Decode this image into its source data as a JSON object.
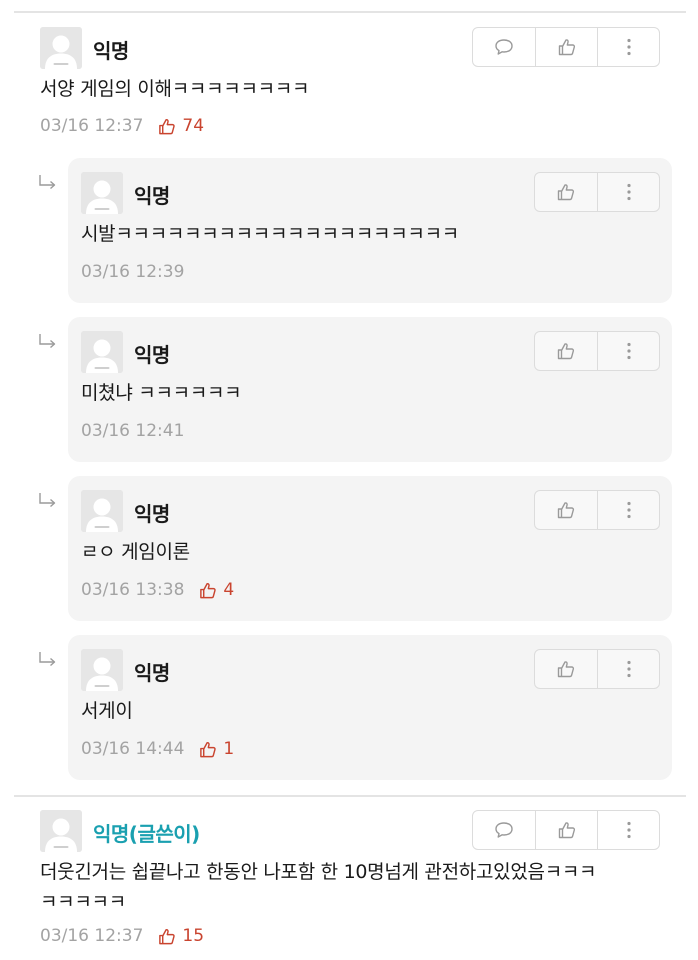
{
  "comments": [
    {
      "kind": "top",
      "author": "익명",
      "is_author": false,
      "text_lines": [
        "서양 게임의 이해ㅋㅋㅋㅋㅋㅋㅋㅋ"
      ],
      "time": "03/16 12:37",
      "likes": "74",
      "actions": [
        "speech-bubble-icon",
        "thumbs-up-icon",
        "more-vertical-icon"
      ]
    },
    {
      "kind": "reply",
      "author": "익명",
      "is_author": false,
      "text_lines": [
        "시발ㅋㅋㅋㅋㅋㅋㅋㅋㅋㅋㅋㅋㅋㅋㅋㅋㅋㅋㅋㅋ"
      ],
      "time": "03/16 12:39",
      "likes": "",
      "actions": [
        "thumbs-up-icon",
        "more-vertical-icon"
      ]
    },
    {
      "kind": "reply",
      "author": "익명",
      "is_author": false,
      "text_lines": [
        "미쳤냐 ㅋㅋㅋㅋㅋㅋ"
      ],
      "time": "03/16 12:41",
      "likes": "",
      "actions": [
        "thumbs-up-icon",
        "more-vertical-icon"
      ]
    },
    {
      "kind": "reply",
      "author": "익명",
      "is_author": false,
      "text_lines": [
        "ㄹㅇ 게임이론"
      ],
      "time": "03/16 13:38",
      "likes": "4",
      "actions": [
        "thumbs-up-icon",
        "more-vertical-icon"
      ]
    },
    {
      "kind": "reply",
      "author": "익명",
      "is_author": false,
      "text_lines": [
        "서게이"
      ],
      "time": "03/16 14:44",
      "likes": "1",
      "actions": [
        "thumbs-up-icon",
        "more-vertical-icon"
      ]
    },
    {
      "kind": "top",
      "author": "익명(글쓴이)",
      "is_author": true,
      "text_lines": [
        "더웃긴거는 쉽끝나고 한동안 나포함 한 10명넘게 관전하고있었음ㅋㅋㅋ",
        "ㅋㅋㅋㅋㅋ"
      ],
      "time": "03/16 12:37",
      "likes": "15",
      "actions": [
        "speech-bubble-icon",
        "thumbs-up-icon",
        "more-vertical-icon"
      ]
    }
  ],
  "colors": {
    "author_name": "#1aa0b0",
    "like_count": "#c9442f",
    "meta_text": "#a3a3a3",
    "reply_bg": "#f4f4f4"
  }
}
